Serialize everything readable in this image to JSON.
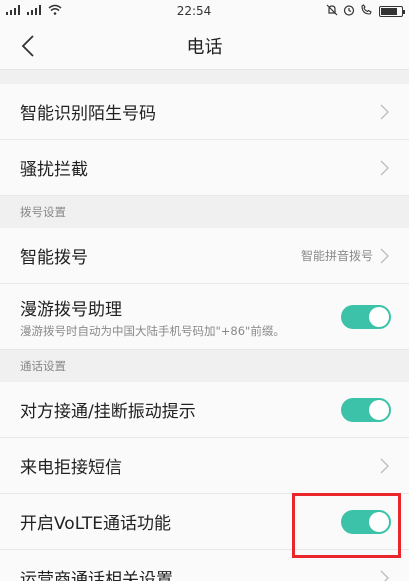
{
  "status_bar": {
    "signal_left": "2G",
    "signal_right": "4G",
    "time": "22:54",
    "icons": [
      "signal-icon",
      "signal-icon",
      "wifi-icon",
      "mute-icon",
      "alarm-icon",
      "call-icon",
      "battery-icon"
    ]
  },
  "header": {
    "title": "电话",
    "back_icon": "back-chevron-icon"
  },
  "rows_group1": [
    {
      "label": "智能识别陌生号码"
    },
    {
      "label": "骚扰拦截"
    }
  ],
  "section_dial": {
    "header": "拨号设置"
  },
  "smart_dial": {
    "label": "智能拨号",
    "value": "智能拼音拨号"
  },
  "roaming": {
    "label": "漫游拨号助理",
    "sub": "漫游拨号时自动为中国大陆手机号码加\"+86\"前缀。",
    "on": true
  },
  "section_call": {
    "header": "通话设置"
  },
  "vibrate": {
    "label": "对方接通/挂断振动提示",
    "on": true
  },
  "reject_sms": {
    "label": "来电拒接短信"
  },
  "volte": {
    "label": "开启VoLTE通话功能",
    "on": true
  },
  "carrier": {
    "label": "运营商通话相关设置"
  },
  "colors": {
    "accent": "#3bc2a8",
    "highlight": "#e8262b"
  }
}
